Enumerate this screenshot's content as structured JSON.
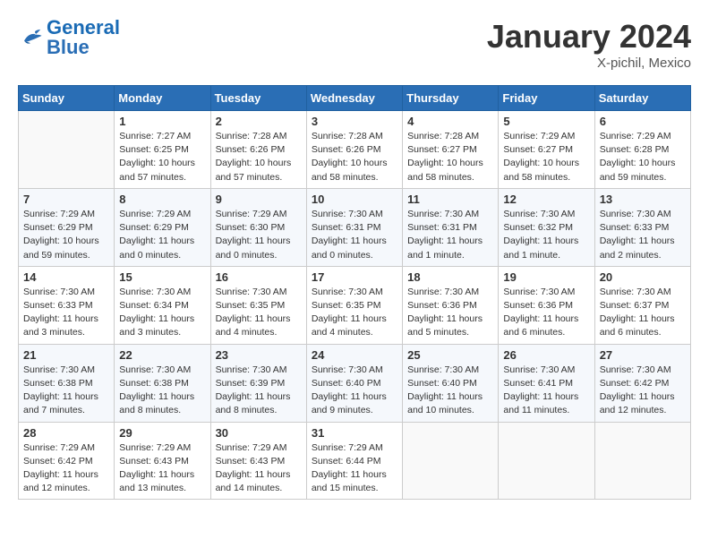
{
  "header": {
    "logo_general": "General",
    "logo_blue": "Blue",
    "month_title": "January 2024",
    "location": "X-pichil, Mexico"
  },
  "calendar": {
    "headers": [
      "Sunday",
      "Monday",
      "Tuesday",
      "Wednesday",
      "Thursday",
      "Friday",
      "Saturday"
    ],
    "weeks": [
      [
        {
          "day": "",
          "info": ""
        },
        {
          "day": "1",
          "info": "Sunrise: 7:27 AM\nSunset: 6:25 PM\nDaylight: 10 hours\nand 57 minutes."
        },
        {
          "day": "2",
          "info": "Sunrise: 7:28 AM\nSunset: 6:26 PM\nDaylight: 10 hours\nand 57 minutes."
        },
        {
          "day": "3",
          "info": "Sunrise: 7:28 AM\nSunset: 6:26 PM\nDaylight: 10 hours\nand 58 minutes."
        },
        {
          "day": "4",
          "info": "Sunrise: 7:28 AM\nSunset: 6:27 PM\nDaylight: 10 hours\nand 58 minutes."
        },
        {
          "day": "5",
          "info": "Sunrise: 7:29 AM\nSunset: 6:27 PM\nDaylight: 10 hours\nand 58 minutes."
        },
        {
          "day": "6",
          "info": "Sunrise: 7:29 AM\nSunset: 6:28 PM\nDaylight: 10 hours\nand 59 minutes."
        }
      ],
      [
        {
          "day": "7",
          "info": "Sunrise: 7:29 AM\nSunset: 6:29 PM\nDaylight: 10 hours\nand 59 minutes."
        },
        {
          "day": "8",
          "info": "Sunrise: 7:29 AM\nSunset: 6:29 PM\nDaylight: 11 hours\nand 0 minutes."
        },
        {
          "day": "9",
          "info": "Sunrise: 7:29 AM\nSunset: 6:30 PM\nDaylight: 11 hours\nand 0 minutes."
        },
        {
          "day": "10",
          "info": "Sunrise: 7:30 AM\nSunset: 6:31 PM\nDaylight: 11 hours\nand 0 minutes."
        },
        {
          "day": "11",
          "info": "Sunrise: 7:30 AM\nSunset: 6:31 PM\nDaylight: 11 hours\nand 1 minute."
        },
        {
          "day": "12",
          "info": "Sunrise: 7:30 AM\nSunset: 6:32 PM\nDaylight: 11 hours\nand 1 minute."
        },
        {
          "day": "13",
          "info": "Sunrise: 7:30 AM\nSunset: 6:33 PM\nDaylight: 11 hours\nand 2 minutes."
        }
      ],
      [
        {
          "day": "14",
          "info": "Sunrise: 7:30 AM\nSunset: 6:33 PM\nDaylight: 11 hours\nand 3 minutes."
        },
        {
          "day": "15",
          "info": "Sunrise: 7:30 AM\nSunset: 6:34 PM\nDaylight: 11 hours\nand 3 minutes."
        },
        {
          "day": "16",
          "info": "Sunrise: 7:30 AM\nSunset: 6:35 PM\nDaylight: 11 hours\nand 4 minutes."
        },
        {
          "day": "17",
          "info": "Sunrise: 7:30 AM\nSunset: 6:35 PM\nDaylight: 11 hours\nand 4 minutes."
        },
        {
          "day": "18",
          "info": "Sunrise: 7:30 AM\nSunset: 6:36 PM\nDaylight: 11 hours\nand 5 minutes."
        },
        {
          "day": "19",
          "info": "Sunrise: 7:30 AM\nSunset: 6:36 PM\nDaylight: 11 hours\nand 6 minutes."
        },
        {
          "day": "20",
          "info": "Sunrise: 7:30 AM\nSunset: 6:37 PM\nDaylight: 11 hours\nand 6 minutes."
        }
      ],
      [
        {
          "day": "21",
          "info": "Sunrise: 7:30 AM\nSunset: 6:38 PM\nDaylight: 11 hours\nand 7 minutes."
        },
        {
          "day": "22",
          "info": "Sunrise: 7:30 AM\nSunset: 6:38 PM\nDaylight: 11 hours\nand 8 minutes."
        },
        {
          "day": "23",
          "info": "Sunrise: 7:30 AM\nSunset: 6:39 PM\nDaylight: 11 hours\nand 8 minutes."
        },
        {
          "day": "24",
          "info": "Sunrise: 7:30 AM\nSunset: 6:40 PM\nDaylight: 11 hours\nand 9 minutes."
        },
        {
          "day": "25",
          "info": "Sunrise: 7:30 AM\nSunset: 6:40 PM\nDaylight: 11 hours\nand 10 minutes."
        },
        {
          "day": "26",
          "info": "Sunrise: 7:30 AM\nSunset: 6:41 PM\nDaylight: 11 hours\nand 11 minutes."
        },
        {
          "day": "27",
          "info": "Sunrise: 7:30 AM\nSunset: 6:42 PM\nDaylight: 11 hours\nand 12 minutes."
        }
      ],
      [
        {
          "day": "28",
          "info": "Sunrise: 7:29 AM\nSunset: 6:42 PM\nDaylight: 11 hours\nand 12 minutes."
        },
        {
          "day": "29",
          "info": "Sunrise: 7:29 AM\nSunset: 6:43 PM\nDaylight: 11 hours\nand 13 minutes."
        },
        {
          "day": "30",
          "info": "Sunrise: 7:29 AM\nSunset: 6:43 PM\nDaylight: 11 hours\nand 14 minutes."
        },
        {
          "day": "31",
          "info": "Sunrise: 7:29 AM\nSunset: 6:44 PM\nDaylight: 11 hours\nand 15 minutes."
        },
        {
          "day": "",
          "info": ""
        },
        {
          "day": "",
          "info": ""
        },
        {
          "day": "",
          "info": ""
        }
      ]
    ]
  }
}
